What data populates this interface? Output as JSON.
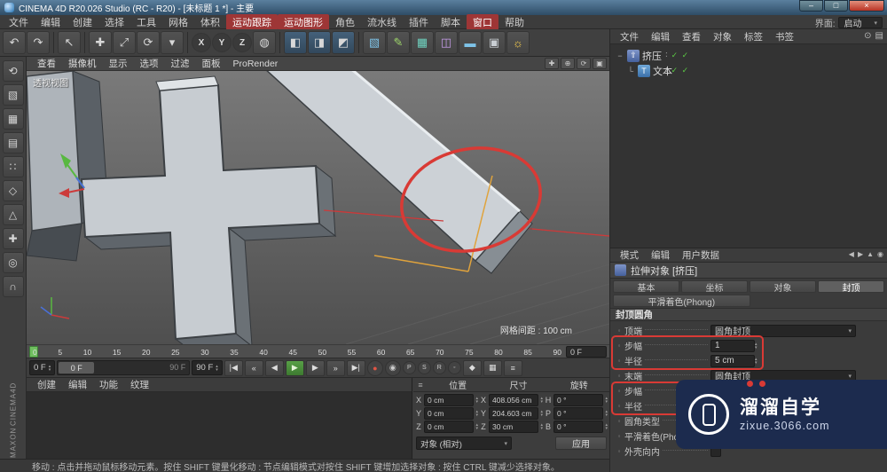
{
  "colors": {
    "annotation_red": "#d93a35",
    "menu_highlight": "#9e3636",
    "play_green": "#4a9a3f",
    "check_green": "#5bc944",
    "watermark_bg": "#1c2b4e",
    "axis_red": "#cc3b3b",
    "axis_green": "#58b840",
    "axis_blue": "#4a6fd8",
    "handle_orange": "#e0a33c"
  },
  "window": {
    "title": "CINEMA 4D R20.026 Studio (RC - R20) - [未标题 1 *] - 主要",
    "minimize": "–",
    "maximize": "□",
    "close": "×"
  },
  "menu_bar": {
    "items": [
      {
        "label": "文件"
      },
      {
        "label": "编辑"
      },
      {
        "label": "创建"
      },
      {
        "label": "选择"
      },
      {
        "label": "工具"
      },
      {
        "label": "网格"
      },
      {
        "label": "体积"
      },
      {
        "label": "运动跟踪"
      },
      {
        "label": "运动图形"
      },
      {
        "label": "角色"
      },
      {
        "label": "流水线"
      },
      {
        "label": "插件"
      },
      {
        "label": "脚本"
      },
      {
        "label": "窗口"
      },
      {
        "label": "帮助"
      }
    ],
    "interface_label": "界面:",
    "interface_value": "启动"
  },
  "toolbar": {
    "buttons": [
      {
        "name": "undo",
        "g": "↶"
      },
      {
        "name": "redo",
        "g": "↷"
      },
      {
        "name": "live-selection",
        "g": "↖"
      },
      {
        "name": "move",
        "g": "✚"
      },
      {
        "name": "scale",
        "g": "⤢"
      },
      {
        "name": "rotate",
        "g": "⟳"
      },
      {
        "name": "last-tool",
        "g": "▾"
      },
      {
        "name": "lock-x",
        "g": "X"
      },
      {
        "name": "lock-y",
        "g": "Y"
      },
      {
        "name": "lock-z",
        "g": "Z"
      },
      {
        "name": "coord-system",
        "g": "◍"
      },
      {
        "name": "render-view",
        "g": "◧"
      },
      {
        "name": "render-picture-viewer",
        "g": "◨"
      },
      {
        "name": "render-settings",
        "g": "◩"
      },
      {
        "name": "add-cube",
        "g": "▧"
      },
      {
        "name": "add-spline",
        "g": "✎"
      },
      {
        "name": "add-subdivision",
        "g": "▦"
      },
      {
        "name": "add-deformer",
        "g": "◫"
      },
      {
        "name": "add-floor",
        "g": "▬"
      },
      {
        "name": "add-camera",
        "g": "▣"
      },
      {
        "name": "add-light",
        "g": "☼"
      }
    ]
  },
  "left_toolbar": {
    "buttons": [
      {
        "name": "make-editable",
        "g": "⟲"
      },
      {
        "name": "model-mode",
        "g": "▧"
      },
      {
        "name": "texture-mode",
        "g": "▦"
      },
      {
        "name": "workplane-mode",
        "g": "▤"
      },
      {
        "name": "points-mode",
        "g": "∷"
      },
      {
        "name": "edges-mode",
        "g": "◇"
      },
      {
        "name": "polygons-mode",
        "g": "△"
      },
      {
        "name": "enable-axis",
        "g": "✚"
      },
      {
        "name": "viewport-solo",
        "g": "◎"
      },
      {
        "name": "snap",
        "g": "∩"
      }
    ]
  },
  "viewport": {
    "menus": [
      "查看",
      "摄像机",
      "显示",
      "选项",
      "过滤",
      "面板",
      "ProRender"
    ],
    "nav": [
      {
        "name": "pan",
        "g": "✚"
      },
      {
        "name": "zoom",
        "g": "⊕"
      },
      {
        "name": "orbit",
        "g": "⟳"
      },
      {
        "name": "toggle-view",
        "g": "▣"
      }
    ],
    "view_label": "透视视图",
    "grid_text": "网格间距 : 100 cm"
  },
  "timeline": {
    "ticks": [
      "0",
      "5",
      "10",
      "15",
      "20",
      "25",
      "30",
      "35",
      "40",
      "45",
      "50",
      "55",
      "60",
      "65",
      "70",
      "75",
      "80",
      "85",
      "90"
    ],
    "hud_frame": "0 F",
    "current_frame": "0 F",
    "slider_start": "0 F",
    "slider_end": "90 F",
    "end_frame": "90 F",
    "transport": [
      {
        "name": "goto-start",
        "g": "|◀"
      },
      {
        "name": "prev-key",
        "g": "«"
      },
      {
        "name": "prev-frame",
        "g": "◀"
      },
      {
        "name": "play",
        "g": "▶"
      },
      {
        "name": "next-frame",
        "g": "▶"
      },
      {
        "name": "next-key",
        "g": "»"
      },
      {
        "name": "goto-end",
        "g": "▶|"
      }
    ],
    "record": [
      {
        "name": "record-keyframe",
        "g": "●"
      },
      {
        "name": "autokey",
        "g": "◉"
      },
      {
        "name": "record-position",
        "g": "P"
      },
      {
        "name": "record-scale",
        "g": "S"
      },
      {
        "name": "record-rotation",
        "g": "R"
      },
      {
        "name": "record-pla",
        "g": "◦"
      }
    ],
    "extra": [
      {
        "name": "key-selection",
        "g": "◆"
      },
      {
        "name": "keying-settings",
        "g": "▦"
      },
      {
        "name": "timeline-options",
        "g": "≡"
      }
    ]
  },
  "material_manager": {
    "menus": [
      "创建",
      "编辑",
      "功能",
      "纹理"
    ]
  },
  "coordinates": {
    "menu_icon": "≡",
    "headers": [
      "位置",
      "尺寸",
      "旋转"
    ],
    "rows": [
      [
        "X",
        "0 cm",
        "X",
        "408.056 cm",
        "H",
        "0 °"
      ],
      [
        "Y",
        "0 cm",
        "Y",
        "204.603 cm",
        "P",
        "0 °"
      ],
      [
        "Z",
        "0 cm",
        "Z",
        "30 cm",
        "B",
        "0 °"
      ]
    ],
    "space": "对象 (相对)",
    "apply": "应用"
  },
  "object_manager": {
    "menus": [
      "文件",
      "编辑",
      "查看",
      "对象",
      "标签",
      "书签"
    ],
    "icons": [
      {
        "name": "search",
        "g": "⊙"
      },
      {
        "name": "filter",
        "g": "▤"
      }
    ],
    "objects": [
      {
        "exp": "−",
        "icon_g": "⇧",
        "name": "挤压",
        "dots": "∶",
        "checks": "✓ ✓"
      },
      {
        "exp": "└",
        "icon_g": "T",
        "name": "文本",
        "dots": "∶",
        "checks": "✓ ✓"
      }
    ]
  },
  "attributes": {
    "menus": [
      "模式",
      "编辑",
      "用户数据"
    ],
    "nav": [
      {
        "name": "back",
        "g": "◀"
      },
      {
        "name": "forward",
        "g": "▶"
      },
      {
        "name": "up",
        "g": "▲"
      },
      {
        "name": "pin",
        "g": "◉"
      }
    ],
    "title": "拉伸对象 [挤压]",
    "tabs": [
      {
        "label": "基本"
      },
      {
        "label": "坐标"
      },
      {
        "label": "对象"
      },
      {
        "label": "封顶"
      }
    ],
    "tab_row2": "平滑着色(Phong)",
    "section": "封顶圆角",
    "fields": [
      {
        "label": "顶端",
        "value": "圆角封顶"
      },
      {
        "label": "步幅",
        "value": "1"
      },
      {
        "label": "半径",
        "value": "5 cm"
      },
      {
        "label": "末端",
        "value": "圆角封顶"
      },
      {
        "label": "步幅",
        "value": ""
      },
      {
        "label": "半径",
        "value": ""
      },
      {
        "label": "圆角类型",
        "value": ""
      },
      {
        "label": "平滑着色(Phong)角度",
        "value": ""
      },
      {
        "label": "外壳向内",
        "value": ""
      }
    ]
  },
  "watermark": {
    "title": "溜溜自学",
    "url": "zixue.3066.com"
  },
  "status_bar": {
    "text": "移动 : 点击并拖动鼠标移动元素。按住 SHIFT 键量化移动 : 节点编辑模式对按住 SHIFT 键增加选择对象 : 按住 CTRL 键减少选择对象。"
  },
  "branding": {
    "line1": "MAXON",
    "line2": "CINEMA4D"
  }
}
